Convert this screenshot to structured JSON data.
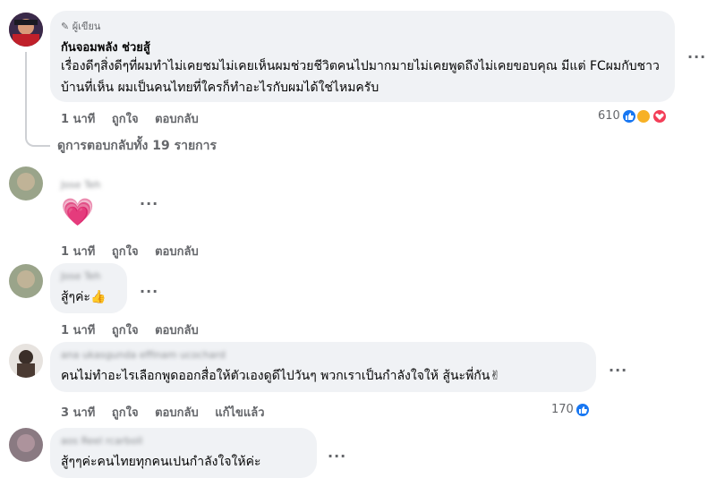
{
  "comments": [
    {
      "author_badge": "ผู้เขียน",
      "author": "กันจอมพลัง ช่วยสู้",
      "text": "เรื่องดีๆสิ่งดีๆที่ผมทำไม่เคยชมไม่เคยเห็นผมช่วยชีวิตคนไปมากมายไม่เคยพูดถึงไม่เคยขอบคุณ มีแต่ FCผมกับชาวบ้านที่เห็น ผมเป็นคนไทยที่ใครก็ทำอะไรกับผมได้ใช่ไหมครับ",
      "time": "1 นาที",
      "like": "ถูกใจ",
      "reply": "ตอบกลับ",
      "reactions": "610",
      "view_replies": "ดูการตอบกลับทั้ง 19 รายการ"
    },
    {
      "author": "Jose Teh",
      "emoji": "💗",
      "time": "1 นาที",
      "like": "ถูกใจ",
      "reply": "ตอบกลับ"
    },
    {
      "author": "Jose Teh",
      "text": "สู้ๆค่ะ👍",
      "time": "1 นาที",
      "like": "ถูกใจ",
      "reply": "ตอบกลับ"
    },
    {
      "author": "ana ukasgunda effinam ucochard",
      "text": "คนไม่ทำอะไรเลือกพูดออกสื่อให้ตัวเองดูดีไปวันๆ พวกเราเป็นกำลังใจให้ สู้นะพี่กัน✌",
      "time": "3 นาที",
      "like": "ถูกใจ",
      "reply": "ตอบกลับ",
      "edited": "แก้ไขแล้ว",
      "reactions": "170"
    },
    {
      "author": "aos Reel rcarboll",
      "text": "สู้ๆๆค่ะคนไทยทุกคนเปนกำลังใจให้ค่ะ"
    }
  ],
  "more_glyph": "···",
  "colors": {
    "bubble": "#f0f2f5",
    "secondary_text": "#65676b",
    "like_blue": "#1877f2",
    "love_red": "#f33e58"
  }
}
